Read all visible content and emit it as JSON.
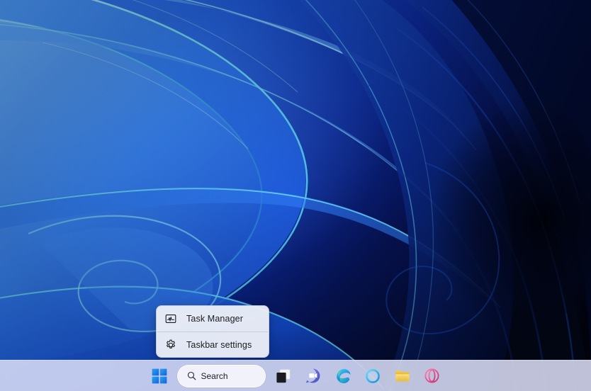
{
  "desktop": {
    "wallpaper_name": "windows-11-bloom-wallpaper",
    "wallpaper_colors": {
      "deep_navy": "#050d3c",
      "dark_blue": "#0a1a6e",
      "mid_blue": "#1450d8",
      "bright_blue": "#2f7bf5",
      "light_blue": "#4f9dff",
      "cyan_edge": "#5fd8f0",
      "pale_cyan": "#a8e8fb",
      "black_shadow": "#01030f"
    }
  },
  "context_menu": {
    "name": "taskbar-context-menu",
    "items": [
      {
        "label": "Task Manager",
        "icon": "task-manager-icon"
      },
      {
        "label": "Taskbar settings",
        "icon": "gear-icon"
      }
    ],
    "background": "#f3f4fa",
    "text_color": "#1b1b1f"
  },
  "taskbar": {
    "background": "#d8dcf3",
    "buttons": [
      {
        "name": "start-button",
        "label": "Start",
        "icon": "windows-logo-icon"
      },
      {
        "name": "search-box",
        "label": "Search",
        "icon": "search-icon"
      },
      {
        "name": "task-view-button",
        "label": "Task View",
        "icon": "task-view-icon"
      },
      {
        "name": "chat-button",
        "label": "Chat",
        "icon": "chat-teams-icon"
      },
      {
        "name": "edge-button",
        "label": "Microsoft Edge",
        "icon": "edge-icon"
      },
      {
        "name": "copilot-button",
        "label": "Copilot",
        "icon": "blue-ring-icon"
      },
      {
        "name": "file-explorer-button",
        "label": "File Explorer",
        "icon": "folder-icon"
      },
      {
        "name": "opera-button",
        "label": "Opera",
        "icon": "opera-icon"
      }
    ],
    "search": {
      "placeholder": "Search",
      "value": "Search"
    },
    "icon_colors": {
      "start_blue": "#0f8ce8",
      "start_blue_dark": "#1565d8",
      "teams_purple": "#5b5fc7",
      "edge_blue": "#0f77d1",
      "edge_green": "#3dc98c",
      "edge_cyan": "#35c1f1",
      "ring_cyan": "#3cbdea",
      "folder_yellow": "#f3c33c",
      "folder_blue": "#1b72c4",
      "opera_pink": "#e8518f"
    }
  }
}
